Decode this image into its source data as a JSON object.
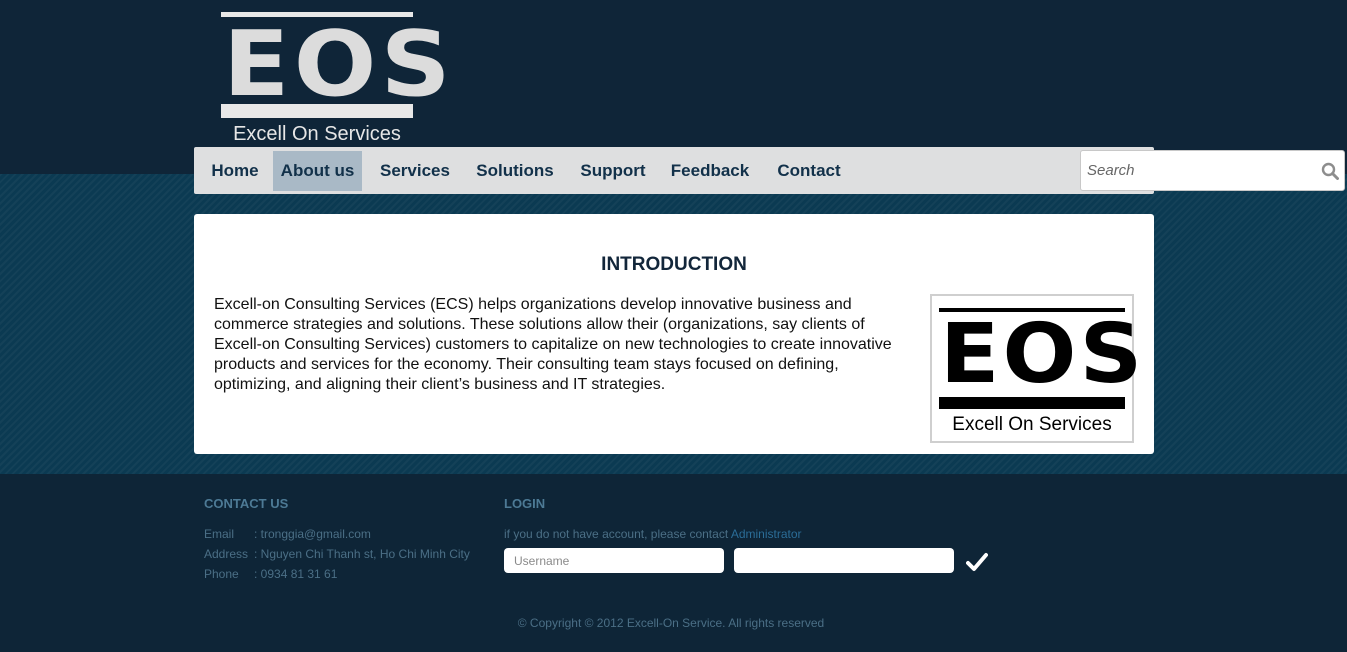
{
  "brand": {
    "logo_letters": "EOS",
    "tagline": "Excell On Services"
  },
  "nav": {
    "items": [
      {
        "label": "Home",
        "active": false
      },
      {
        "label": "About us",
        "active": true
      },
      {
        "label": "Services",
        "active": false
      },
      {
        "label": "Solutions",
        "active": false
      },
      {
        "label": "Support",
        "active": false
      },
      {
        "label": "Feedback",
        "active": false
      },
      {
        "label": "Contact",
        "active": false
      }
    ],
    "search_placeholder": "Search",
    "search_icon": "search-icon"
  },
  "content": {
    "title": "INTRODUCTION",
    "body": "Excell-on Consulting Services (ECS) helps organizations develop innovative business and commerce strategies and solutions. These solutions allow their (organizations, say clients of Excell-on Consulting Services) customers to capitalize on new technologies to create innovative products and services for the economy. Their consulting team stays focused on defining, optimizing, and aligning their client’s business and IT strategies.",
    "side_logo_letters": "EOS",
    "side_logo_tagline": "Excell On Services"
  },
  "footer": {
    "contact": {
      "title": "CONTACT US",
      "rows": [
        {
          "label": "Email",
          "value": ": tronggia@gmail.com"
        },
        {
          "label": "Address",
          "value": ": Nguyen Chi Thanh st, Ho Chi Minh City"
        },
        {
          "label": "Phone",
          "value": ": 0934 81 31 61"
        }
      ]
    },
    "login": {
      "title": "LOGIN",
      "note": "if you do not have account, please contact ",
      "admin_link": "Administrator",
      "username_placeholder": "Username",
      "password_placeholder": "",
      "submit_icon": "checkmark-icon"
    },
    "copyright": "© Copyright © 2012 Excell-On Service. All rights reserved"
  },
  "colors": {
    "header_bg": "#0f2538",
    "band_bg": "#0b3a52",
    "nav_bg": "#dedfe0",
    "nav_active": "#a9b9c6",
    "footer_text": "#4b6f86",
    "link": "#2b6d97"
  }
}
